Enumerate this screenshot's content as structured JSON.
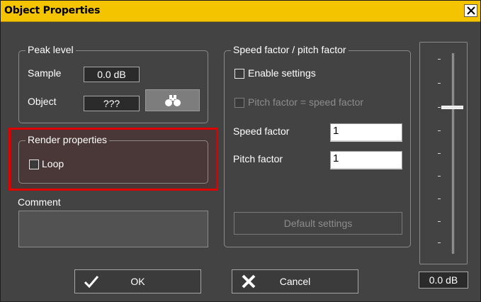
{
  "window": {
    "title": "Object Properties",
    "accent_color": "#f5c400",
    "close_icon": "close-icon"
  },
  "peak_level": {
    "legend": "Peak level",
    "sample_label": "Sample",
    "sample_value": "0.0 dB",
    "object_label": "Object",
    "object_value": "???",
    "find_icon": "binoculars-icon"
  },
  "render_properties": {
    "legend": "Render properties",
    "loop_label": "Loop",
    "loop_checked": false,
    "highlight_color": "#e00000"
  },
  "comment": {
    "label": "Comment",
    "value": ""
  },
  "speed_pitch": {
    "legend": "Speed factor / pitch factor",
    "enable_label": "Enable settings",
    "enable_checked": false,
    "pitch_equals_speed_label": "Pitch factor = speed factor",
    "pitch_equals_speed_checked": false,
    "speed_factor_label": "Speed factor",
    "speed_factor_value": "1",
    "pitch_factor_label": "Pitch factor",
    "pitch_factor_value": "1",
    "default_button_label": "Default settings"
  },
  "volume": {
    "value": "0.0 dB",
    "tick_marks": [
      "-",
      "-",
      "-",
      "-",
      "-",
      "-",
      "-",
      "-",
      "-",
      "-"
    ]
  },
  "buttons": {
    "ok_label": "OK",
    "ok_icon": "checkmark-icon",
    "cancel_label": "Cancel",
    "cancel_icon": "x-icon"
  }
}
